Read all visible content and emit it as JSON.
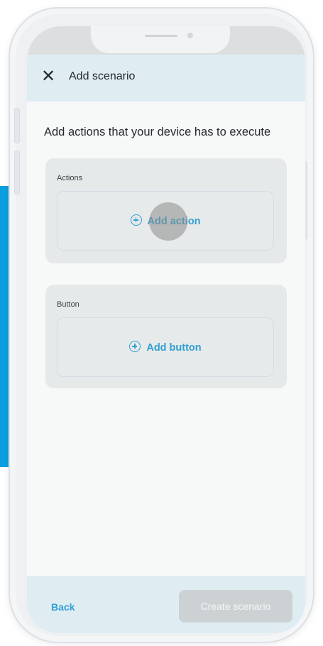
{
  "header": {
    "close_icon": "close-icon",
    "close_glyph": "✕",
    "title": "Add scenario"
  },
  "main": {
    "heading": "Add actions that your device has to execute",
    "actions_card": {
      "label": "Actions",
      "add_label": "Add action",
      "icon": "plus-circle-icon"
    },
    "button_card": {
      "label": "Button",
      "add_label": "Add button",
      "icon": "plus-circle-icon"
    }
  },
  "footer": {
    "back_label": "Back",
    "create_label": "Create scenario"
  },
  "colors": {
    "accent": "#2e9fd2",
    "header_bg": "#dfedf3",
    "disabled_button": "#ccd2d4",
    "side_stripe": "#0aa0e0"
  }
}
